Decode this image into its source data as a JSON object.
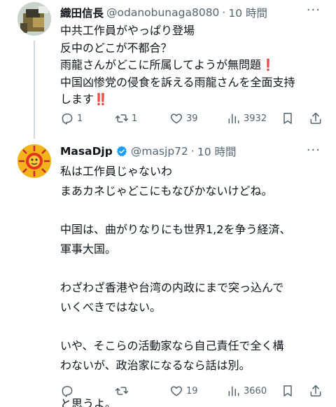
{
  "tweets": [
    {
      "display_name": "織田信長",
      "handle": "@odanobunaga8080",
      "separator": "·",
      "time": "10 時間",
      "lines": [
        {
          "text": "中共工作員がやっぱり登場",
          "emoji": ""
        },
        {
          "text": "反中のどこが不都合？",
          "emoji": ""
        },
        {
          "text": "雨龍さんがどこに所属してようが無問題",
          "emoji": "❗"
        },
        {
          "text": "中国凶惨党の侵食を訴える雨龍さんを全面支持",
          "emoji": ""
        },
        {
          "text": "します",
          "emoji": "‼️"
        }
      ],
      "replies": "1",
      "retweets": "1",
      "likes": "39",
      "views": "3932"
    },
    {
      "display_name": "MasaDjp",
      "handle": "@masjp72",
      "separator": "·",
      "time": "10 時間",
      "verified": true,
      "lines": [
        {
          "text": "私は工作員じゃないわ"
        },
        {
          "text": "まあカネじゃどこにもなびかないけどね。"
        },
        {
          "text": ""
        },
        {
          "text": "中国は、曲がりなりにも世界1,2を争う経済、"
        },
        {
          "text": "軍事大国。"
        },
        {
          "text": ""
        },
        {
          "text": "わざわざ香港や台湾の内政にまで突っ込んで"
        },
        {
          "text": "いくべきではない。"
        },
        {
          "text": ""
        },
        {
          "text": "いや、そこらの活動家なら自己責任で全く構"
        },
        {
          "text": "わないが、政治家になるなら話は別。"
        },
        {
          "text": ""
        },
        {
          "text": "と思うよ。"
        }
      ],
      "replies": "",
      "retweets": "",
      "likes": "19",
      "views": "3660"
    }
  ],
  "more_label": "···",
  "colors": {
    "text": "#0f1419",
    "secondary": "#536471",
    "verified": "#1d9bf0",
    "emoji_red": "#e0245e"
  },
  "icons": [
    "reply-icon",
    "retweet-icon",
    "like-icon",
    "views-icon",
    "bookmark-icon",
    "share-icon",
    "verified-badge-icon",
    "more-icon"
  ]
}
